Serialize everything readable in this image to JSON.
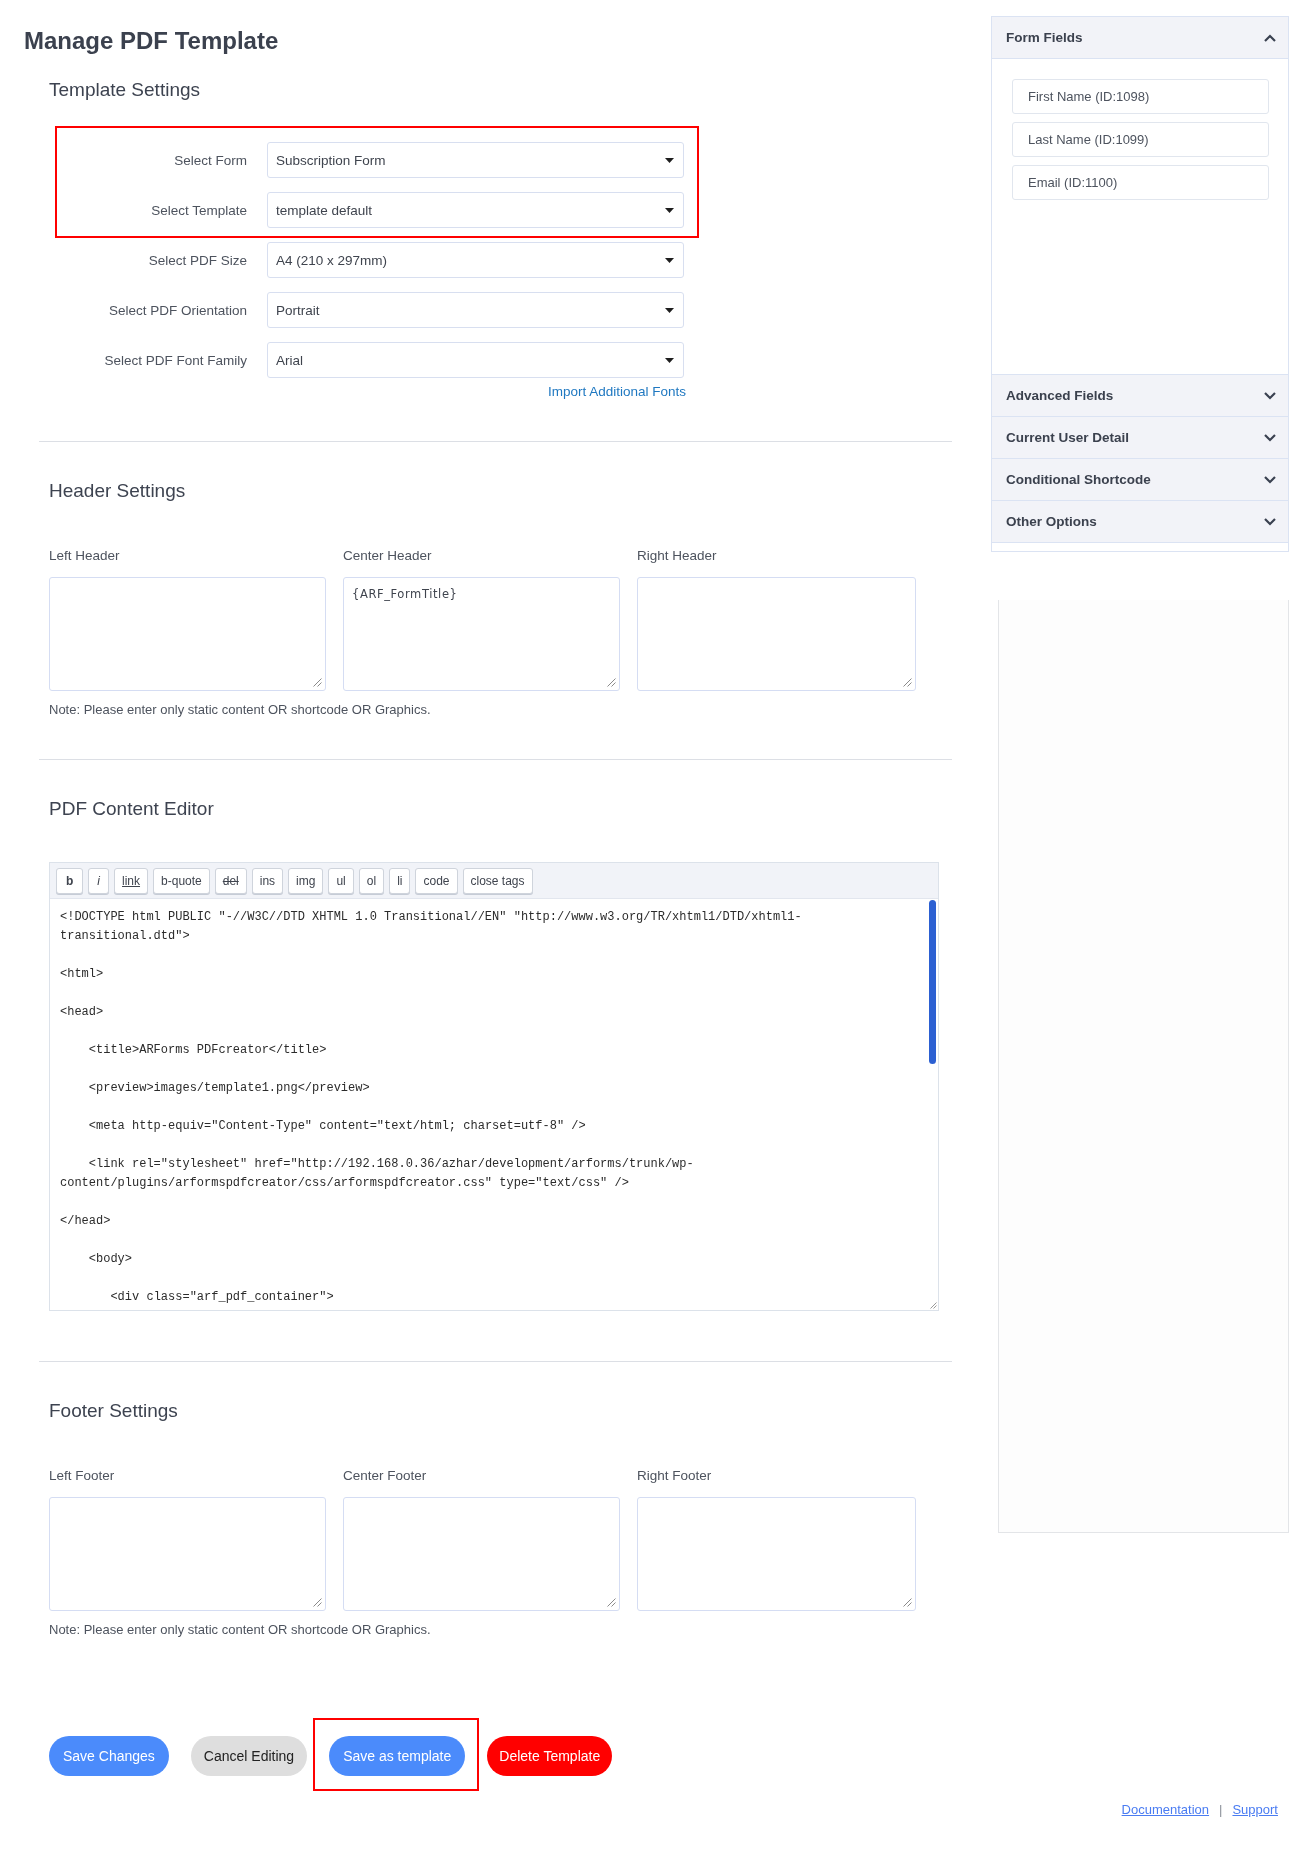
{
  "page_title": "Manage PDF Template",
  "template_settings": {
    "title": "Template Settings",
    "fields": [
      {
        "label": "Select Form",
        "value": "Subscription Form",
        "highlighted": true
      },
      {
        "label": "Select Template",
        "value": "template default",
        "highlighted": true
      },
      {
        "label": "Select PDF Size",
        "value": "A4 (210 x 297mm)",
        "highlighted": false
      },
      {
        "label": "Select PDF Orientation",
        "value": "Portrait",
        "highlighted": false
      },
      {
        "label": "Select PDF Font Family",
        "value": "Arial",
        "highlighted": false
      }
    ],
    "link": "Import Additional Fonts"
  },
  "header_settings": {
    "title": "Header Settings",
    "boxes": [
      {
        "label": "Left Header"
      },
      {
        "label": "Center Header",
        "value": "{ARF_FormTitle}"
      },
      {
        "label": "Right Header"
      }
    ],
    "note": "Note: Please enter only static content OR shortcode OR Graphics."
  },
  "content_editor": {
    "title": "PDF Content Editor",
    "toolbar": [
      {
        "label": "b",
        "kind": "bold"
      },
      {
        "label": "i",
        "kind": "italic"
      },
      {
        "label": "link",
        "kind": "underline"
      },
      {
        "label": "b-quote",
        "kind": "plain"
      },
      {
        "label": "del",
        "kind": "strike"
      },
      {
        "label": "ins",
        "kind": "plain"
      },
      {
        "label": "img",
        "kind": "plain"
      },
      {
        "label": "ul",
        "kind": "plain"
      },
      {
        "label": "ol",
        "kind": "plain"
      },
      {
        "label": "li",
        "kind": "plain"
      },
      {
        "label": "code",
        "kind": "plain"
      },
      {
        "label": "close tags",
        "kind": "plain"
      }
    ],
    "code": "<!DOCTYPE html PUBLIC \"-//W3C//DTD XHTML 1.0 Transitional//EN\" \"http://www.w3.org/TR/xhtml1/DTD/xhtml1-transitional.dtd\">\n\n<html>\n\n<head>\n\n    <title>ARForms PDFcreator</title>\n\n    <preview>images/template1.png</preview>\n\n    <meta http-equiv=\"Content-Type\" content=\"text/html; charset=utf-8\" />\n\n    <link rel=\"stylesheet\" href=\"http://192.168.0.36/azhar/development/arforms/trunk/wp-content/plugins/arformspdfcreator/css/arformspdfcreator.css\" type=\"text/css\" />\n\n</head>\n\n    <body>\n\n       <div class=\"arf_pdf_container\">"
  },
  "footer_settings": {
    "title": "Footer Settings",
    "boxes": [
      {
        "label": "Left Footer"
      },
      {
        "label": "Center Footer"
      },
      {
        "label": "Right Footer"
      }
    ],
    "note": "Note: Please enter only static content OR shortcode OR Graphics."
  },
  "buttons": [
    {
      "label": "Save Changes",
      "kind": "primary",
      "highlighted": false
    },
    {
      "label": "Cancel Editing",
      "kind": "secondary",
      "highlighted": false
    },
    {
      "label": "Save as template",
      "kind": "primary",
      "highlighted": true
    },
    {
      "label": "Delete Template",
      "kind": "danger",
      "highlighted": false
    }
  ],
  "footer_links": {
    "links": [
      "Documentation",
      "Support"
    ],
    "separator": "|"
  },
  "sidebar": {
    "panels": [
      {
        "title": "Form Fields",
        "expanded": true,
        "items": [
          "First Name (ID:1098)",
          "Last Name (ID:1099)",
          "Email (ID:1100)"
        ]
      },
      {
        "title": "Advanced Fields",
        "expanded": false
      },
      {
        "title": "Current User Detail",
        "expanded": false
      },
      {
        "title": "Conditional Shortcode",
        "expanded": false
      },
      {
        "title": "Other Options",
        "expanded": false
      }
    ]
  }
}
